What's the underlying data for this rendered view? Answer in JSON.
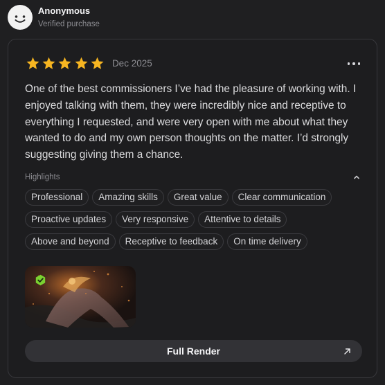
{
  "reviewer": {
    "name": "Anonymous",
    "subtitle": "Verified purchase"
  },
  "review": {
    "rating": 5,
    "rating_max": 5,
    "star_icon": "star-icon",
    "star_color": "#f6b521",
    "date": "Dec 2025",
    "more_icon": "more-horizontal-icon",
    "body": "One of the best commissioners I’ve had the pleasure of working with. I enjoyed talking with them, they were incredibly nice and receptive to everything I requested, and were very open with me about what they wanted to do and my own person thoughts on the matter. I’d strongly suggesting giving them a chance."
  },
  "highlights": {
    "title": "Highlights",
    "toggle_icon": "chevron-up-icon",
    "rows": [
      [
        "Professional",
        "Amazing skills",
        "Great value",
        "Clear communication"
      ],
      [
        "Proactive updates",
        "Very responsive",
        "Attentive to details"
      ],
      [
        "Above and beyond",
        "Receptive to feedback",
        "On time delivery"
      ]
    ]
  },
  "attachment": {
    "badge_icon": "verified-check-icon",
    "badge_color": "#7ad131"
  },
  "full_render": {
    "label": "Full Render",
    "icon": "arrow-up-right-icon"
  },
  "colors": {
    "background": "#1f1f21",
    "card_border": "#38383c",
    "button_bg": "#323236"
  }
}
